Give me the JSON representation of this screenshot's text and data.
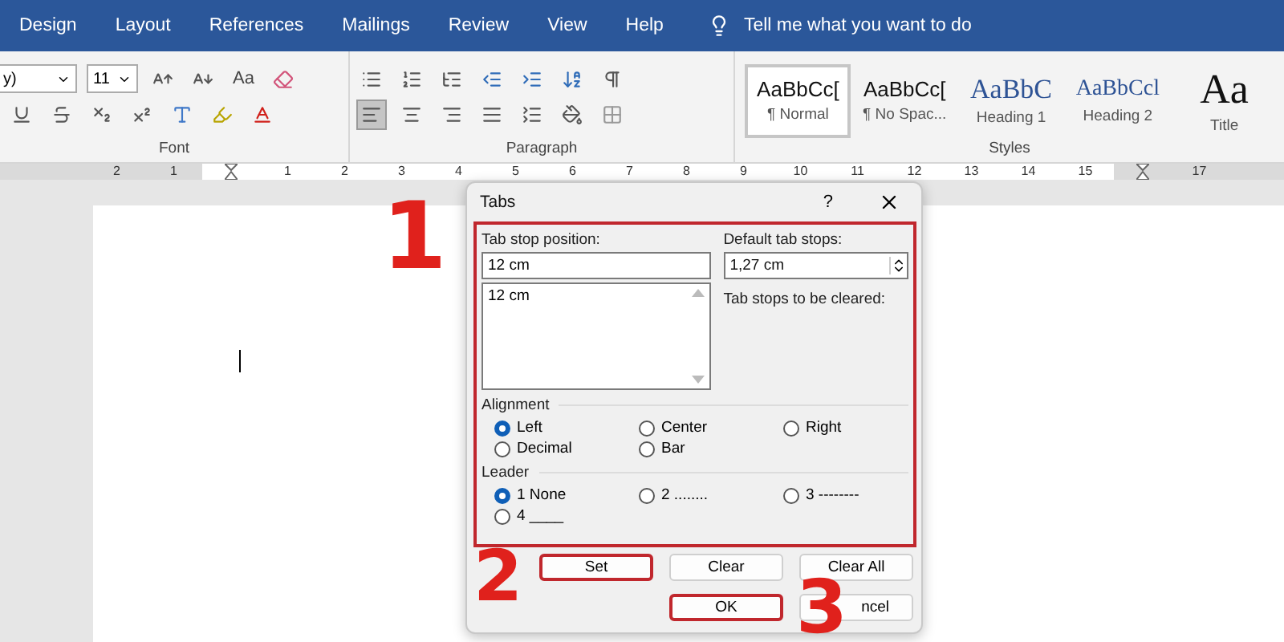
{
  "ribbon_tabs": [
    "Design",
    "Layout",
    "References",
    "Mailings",
    "Review",
    "View",
    "Help"
  ],
  "tell_me": {
    "placeholder": "Tell me what you want to do"
  },
  "font_group": {
    "font_name": "y)",
    "font_size": "11",
    "case_label": "Aa",
    "label": "Font"
  },
  "paragraph_group": {
    "alignment": [
      {
        "kind": "left",
        "selected": true
      },
      {
        "kind": "center",
        "selected": false
      },
      {
        "kind": "right",
        "selected": false
      },
      {
        "kind": "justify",
        "selected": false
      }
    ],
    "label": "Paragraph"
  },
  "styles_group": {
    "styles": [
      {
        "sample": "AaBbCc[",
        "name": "¶ Normal",
        "kind": "body",
        "selected": true
      },
      {
        "sample": "AaBbCc[",
        "name": "¶ No Spac...",
        "kind": "body",
        "selected": false
      },
      {
        "sample": "AaBbC",
        "name": "Heading 1",
        "kind": "heading1",
        "selected": false
      },
      {
        "sample": "AaBbCcl",
        "name": "Heading 2",
        "kind": "heading2",
        "selected": false
      },
      {
        "sample": "Aa",
        "name": "Title",
        "kind": "title",
        "selected": false
      }
    ],
    "label": "Styles"
  },
  "ruler": [
    {
      "kind": "number",
      "label": "2"
    },
    {
      "kind": "number",
      "label": "1"
    },
    {
      "kind": "marker"
    },
    {
      "kind": "number",
      "label": "1"
    },
    {
      "kind": "number",
      "label": "2"
    },
    {
      "kind": "number",
      "label": "3"
    },
    {
      "kind": "number",
      "label": "4"
    },
    {
      "kind": "number",
      "label": "5"
    },
    {
      "kind": "number",
      "label": "6"
    },
    {
      "kind": "number",
      "label": "7"
    },
    {
      "kind": "number",
      "label": "8"
    },
    {
      "kind": "number",
      "label": "9"
    },
    {
      "kind": "number",
      "label": "10"
    },
    {
      "kind": "number",
      "label": "11"
    },
    {
      "kind": "number",
      "label": "12"
    },
    {
      "kind": "number",
      "label": "13"
    },
    {
      "kind": "number",
      "label": "14"
    },
    {
      "kind": "number",
      "label": "15"
    },
    {
      "kind": "marker"
    },
    {
      "kind": "number",
      "label": "17"
    }
  ],
  "dialog": {
    "title": "Tabs",
    "help": "?",
    "outlined": true,
    "tab_stop_position": {
      "label": "Tab stop position:",
      "value": "12 cm",
      "list": [
        "12 cm"
      ]
    },
    "default_tab_stops": {
      "label": "Default tab stops:",
      "value": "1,27 cm"
    },
    "to_be_cleared": {
      "label": "Tab stops to be cleared:"
    },
    "alignment": {
      "label": "Alignment",
      "options": [
        {
          "label": "Left",
          "selected": true
        },
        {
          "label": "Center",
          "selected": false
        },
        {
          "label": "Right",
          "selected": false
        },
        {
          "label": "Decimal",
          "selected": false
        },
        {
          "label": "Bar",
          "selected": false
        }
      ]
    },
    "leader": {
      "label": "Leader",
      "options": [
        {
          "label": "1 None",
          "selected": true
        },
        {
          "label": "2 ........",
          "selected": false
        },
        {
          "label": "3 --------",
          "selected": false
        },
        {
          "label": "4 ____",
          "selected": false
        }
      ]
    },
    "buttons": [
      {
        "label": "Set",
        "outlined": true
      },
      {
        "label": "Clear",
        "outlined": false
      },
      {
        "label": "Clear All",
        "outlined": false
      },
      {
        "label": "OK",
        "outlined": true
      },
      {
        "label": "ncel",
        "outlined": false
      }
    ]
  },
  "annotations": [
    "1",
    "2",
    "3"
  ]
}
